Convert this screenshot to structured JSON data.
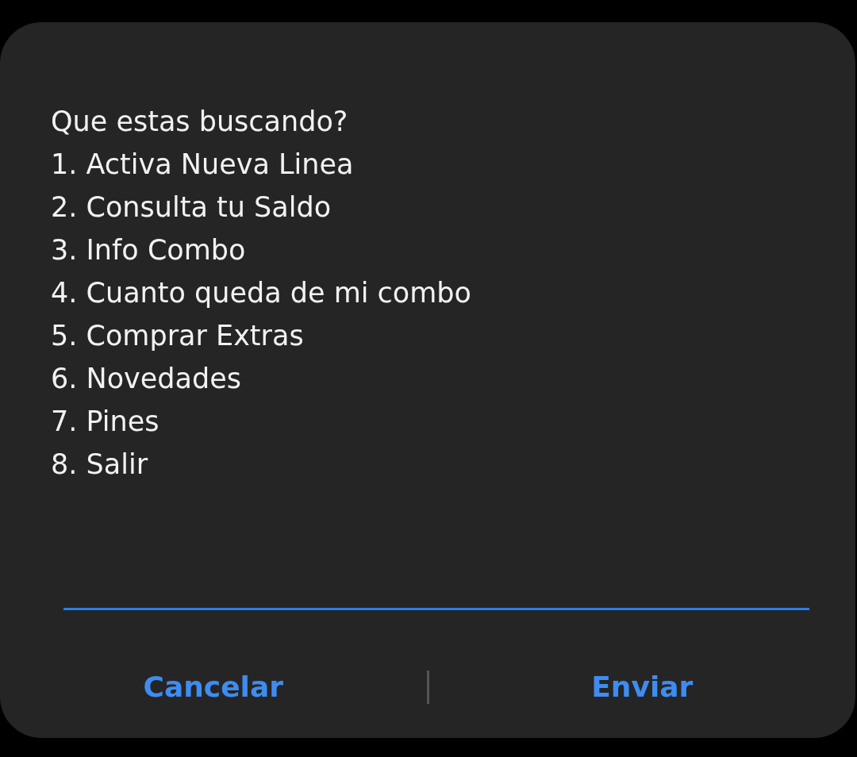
{
  "dialog": {
    "title": "Que estas buscando?",
    "options": [
      "1. Activa Nueva Linea",
      "2. Consulta tu Saldo",
      "3. Info Combo",
      "4. Cuanto queda de mi combo",
      "5. Comprar Extras",
      "6. Novedades",
      "7. Pines",
      "8. Salir"
    ],
    "input": {
      "focused": true
    },
    "buttons": [
      "Cancelar",
      "Enviar"
    ]
  }
}
